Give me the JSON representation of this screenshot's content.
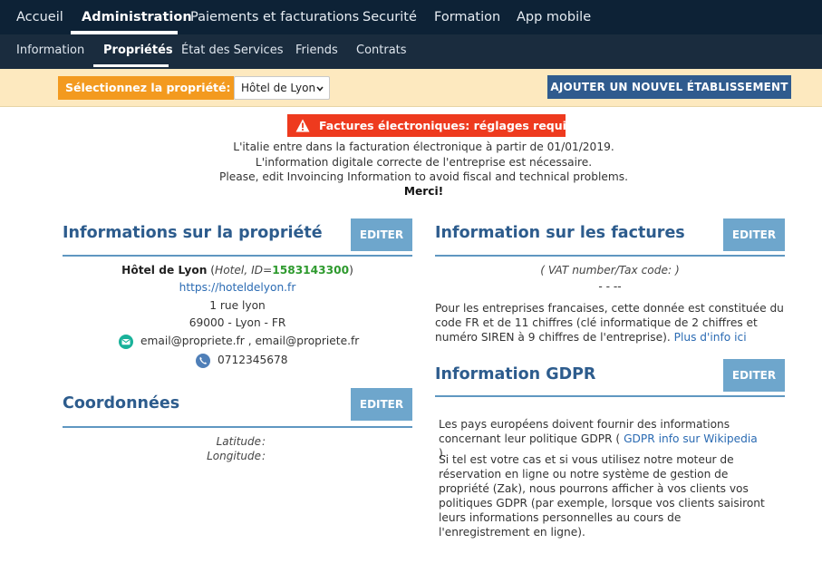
{
  "top_nav": {
    "items": [
      {
        "label": "Accueil",
        "active": false
      },
      {
        "label": "Administration",
        "active": true
      },
      {
        "label": "Paiements et facturations",
        "active": false
      },
      {
        "label": "Securité",
        "active": false
      },
      {
        "label": "Formation",
        "active": false
      },
      {
        "label": "App mobile",
        "active": false
      }
    ]
  },
  "sub_nav": {
    "items": [
      {
        "label": "Information",
        "active": false
      },
      {
        "label": "Propriétés",
        "active": true
      },
      {
        "label": "État des Services",
        "active": false
      },
      {
        "label": "Friends",
        "active": false
      },
      {
        "label": "Contrats",
        "active": false
      }
    ]
  },
  "property_select": {
    "label": "Sélectionnez la propriété:",
    "selected": "Hôtel de Lyon",
    "add_button": "AJOUTER UN NOUVEL ÉTABLISSEMENT"
  },
  "alert": {
    "title": "Factures électroniques: réglages requis",
    "line1": "L'italie entre dans la facturation électronique à partir de 01/01/2019.",
    "line2": "L'information digitale correcte de l'entreprise est nécessaire.",
    "line3": "Please, edit Invoincing Information to avoid fiscal and technical problems.",
    "thanks": "Merci!"
  },
  "property_info": {
    "title": "Informations sur la propriété",
    "edit": "EDITER",
    "name": "Hôtel de Lyon",
    "open_paren": " (",
    "type_id": "Hotel, ID=",
    "id": "1583143300",
    "close_paren": ")",
    "website": "https://hoteldelyon.fr",
    "street": "1 rue lyon",
    "city": "69000 - Lyon - FR",
    "emails": "email@propriete.fr , email@propriete.fr",
    "phone": "0712345678"
  },
  "coordinates": {
    "title": "Coordonnées",
    "edit": "EDITER",
    "latitude_label": "Latitude",
    "longitude_label": "Longitude",
    "colon": ":"
  },
  "invoice_info": {
    "title": "Information sur les factures",
    "edit": "EDITER",
    "vat_label": "( VAT number/Tax code: )",
    "vat_value": "- - --",
    "note": "Pour les entreprises francaises, cette donnée est constituée du code FR et de 11 chiffres (clé informatique de 2 chiffres et numéro SIREN à 9 chiffres de l'entreprise).",
    "more_link": "Plus d'info ici"
  },
  "gdpr": {
    "title": "Information GDPR",
    "edit": "EDITER",
    "p1_before": "Les pays européens doivent fournir des informations concernant leur politique GDPR (",
    "p1_link": "GDPR info sur Wikipedia",
    "p1_after": ").",
    "p2": "Si tel est votre cas et si vous utilisez notre moteur de réservation en ligne ou notre système de gestion de propriété (Zak), nous pourrons afficher à vos clients vos politiques GDPR (par exemple, lorsque vos clients saisiront leurs informations personnelles au cours de l'enregistrement en ligne)."
  },
  "colors": {
    "top_nav_bg": "#0d2236",
    "sub_nav_bg": "#1a2c3e",
    "select_bar_bg": "#fde9bf",
    "label_orange": "#f39a1f",
    "add_button_blue": "#2f5b8e",
    "alert_red": "#ee3a1e",
    "section_title_blue": "#2d5c8d",
    "edit_button_blue": "#6ea6cc",
    "id_green": "#2e9a2e",
    "email_icon_green": "#19b29a",
    "phone_icon_blue": "#4f7fb8"
  }
}
